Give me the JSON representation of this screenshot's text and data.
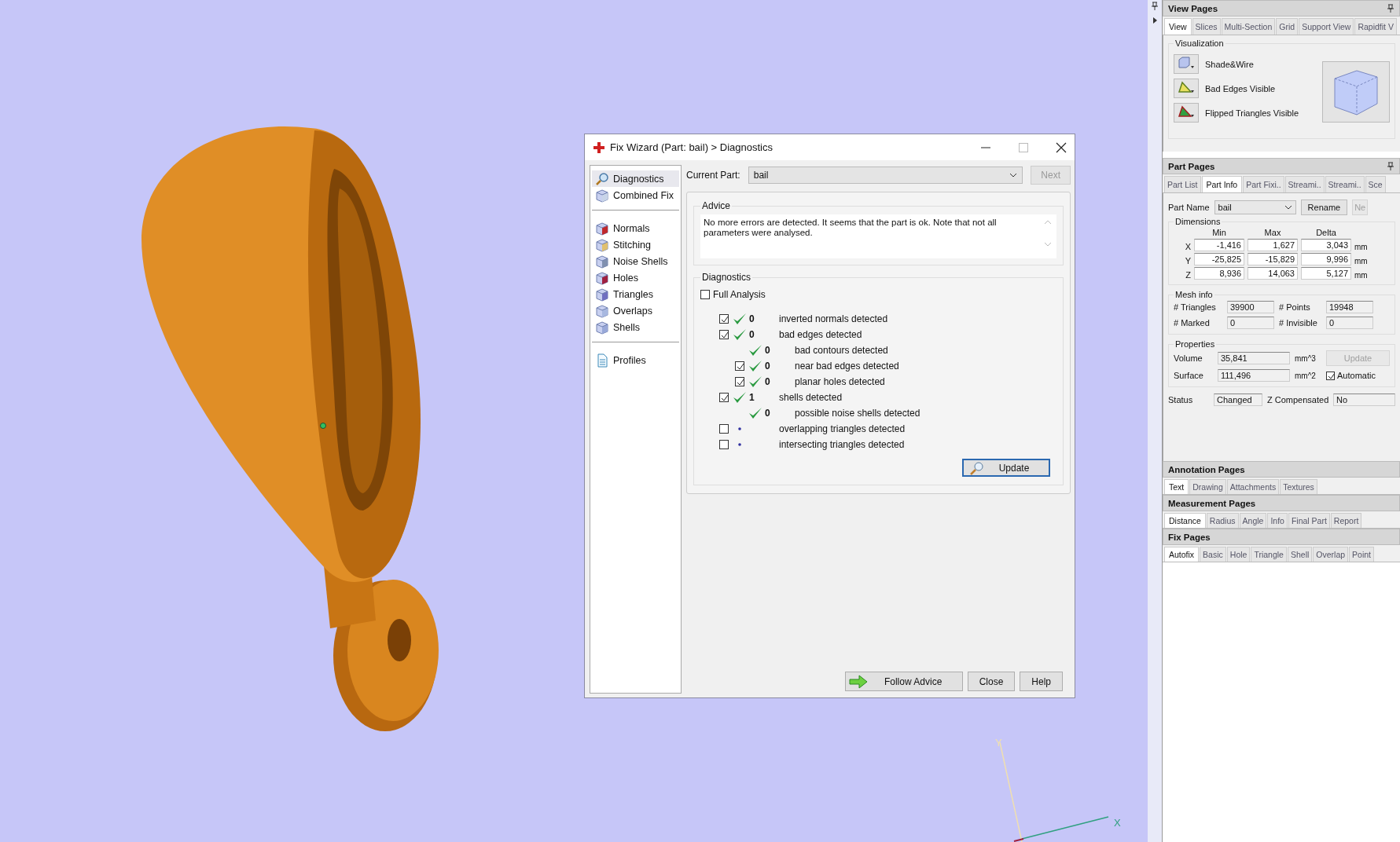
{
  "viewport": {
    "axes": {
      "x_label": "X",
      "y_label": "Y"
    }
  },
  "dialog": {
    "title": "Fix Wizard (Part: bail) > Diagnostics",
    "nav_groups": [
      [
        {
          "label": "Diagnostics",
          "selected": true
        },
        {
          "label": "Combined Fix",
          "selected": false
        }
      ],
      [
        {
          "label": "Normals",
          "selected": false
        },
        {
          "label": "Stitching",
          "selected": false
        },
        {
          "label": "Noise Shells",
          "selected": false
        },
        {
          "label": "Holes",
          "selected": false
        },
        {
          "label": "Triangles",
          "selected": false
        },
        {
          "label": "Overlaps",
          "selected": false
        },
        {
          "label": "Shells",
          "selected": false
        }
      ],
      [
        {
          "label": "Profiles",
          "selected": false
        }
      ]
    ],
    "current_part_label": "Current Part:",
    "current_part": "bail",
    "next_button": {
      "label": "Next",
      "disabled": true
    },
    "advice": {
      "title": "Advice",
      "text": "No more errors are detected. It seems that the part is ok. Note that not all parameters were analysed."
    },
    "diagnostics": {
      "title": "Diagnostics",
      "full_analysis": {
        "label": "Full Analysis",
        "checked": false
      },
      "items": [
        {
          "kind": "checkbox",
          "checked": true,
          "passed": true,
          "count": "0",
          "label": "inverted normals detected"
        },
        {
          "kind": "checkbox",
          "checked": true,
          "passed": true,
          "count": "0",
          "label": "bad edges detected",
          "children": [
            {
              "kind": "plain",
              "passed": true,
              "count": "0",
              "label": "bad contours detected"
            },
            {
              "kind": "checkbox",
              "checked": true,
              "passed": true,
              "count": "0",
              "label": "near bad edges detected"
            },
            {
              "kind": "checkbox",
              "checked": true,
              "passed": true,
              "count": "0",
              "label": "planar holes detected"
            }
          ]
        },
        {
          "kind": "checkbox",
          "checked": true,
          "passed": true,
          "count": "1",
          "label": "shells detected",
          "children": [
            {
              "kind": "plain",
              "passed": true,
              "count": "0",
              "label": "possible noise shells detected"
            }
          ]
        },
        {
          "kind": "checkbox",
          "checked": false,
          "passed": false,
          "label": "overlapping triangles detected"
        },
        {
          "kind": "checkbox",
          "checked": false,
          "passed": false,
          "label": "intersecting triangles detected"
        }
      ],
      "update_button": "Update"
    },
    "buttons": [
      {
        "label": "Follow Advice",
        "kind": "advice"
      },
      {
        "label": "Close",
        "kind": "plain"
      },
      {
        "label": "Help",
        "kind": "plain"
      }
    ]
  },
  "panel": {
    "view_pages": {
      "title": "View Pages",
      "tabs": [
        {
          "label": "View",
          "selected": true
        },
        {
          "label": "Slices",
          "selected": false
        },
        {
          "label": "Multi-Section",
          "selected": false
        },
        {
          "label": "Grid",
          "selected": false
        },
        {
          "label": "Support View",
          "selected": false
        },
        {
          "label": "Rapidfit V",
          "selected": false
        }
      ],
      "group": "Visualization",
      "toggles": [
        {
          "label": "Shade&Wire",
          "kind": "shade"
        },
        {
          "label": "Bad Edges Visible",
          "kind": "edges"
        },
        {
          "label": "Flipped Triangles Visible",
          "kind": "flipped"
        }
      ]
    },
    "part_pages": {
      "title": "Part Pages",
      "tabs": [
        {
          "label": "Part List",
          "selected": false
        },
        {
          "label": "Part Info",
          "selected": true
        },
        {
          "label": "Part Fixi..",
          "selected": false
        },
        {
          "label": "Streami..",
          "selected": false
        },
        {
          "label": "Streami..",
          "selected": false
        },
        {
          "label": "Sce",
          "selected": false
        }
      ],
      "part_name_label": "Part Name",
      "part_name": "bail",
      "rename_button": "Rename",
      "new_button": {
        "label": "Ne",
        "disabled": true
      },
      "dimensions": {
        "title": "Dimensions",
        "columns": [
          "Min",
          "Max",
          "Delta"
        ],
        "rows": [
          {
            "axis": "X",
            "values": [
              "-1,416",
              "1,627",
              "3,043"
            ],
            "unit": "mm"
          },
          {
            "axis": "Y",
            "values": [
              "-25,825",
              "-15,829",
              "9,996"
            ],
            "unit": "mm"
          },
          {
            "axis": "Z",
            "values": [
              "8,936",
              "14,063",
              "5,127"
            ],
            "unit": "mm"
          }
        ]
      },
      "mesh_info": {
        "title": "Mesh info",
        "fields": [
          {
            "label": "# Triangles",
            "value": "39900"
          },
          {
            "label": "# Points",
            "value": "19948"
          },
          {
            "label": "# Marked",
            "value": "0"
          },
          {
            "label": "# Invisible",
            "value": "0"
          }
        ]
      },
      "properties": {
        "title": "Properties",
        "fields": [
          {
            "label": "Volume",
            "value": "35,841",
            "unit": "mm^3"
          },
          {
            "label": "Surface",
            "value": "111,496",
            "unit": "mm^2"
          }
        ],
        "update_button": {
          "label": "Update",
          "disabled": true
        },
        "automatic": {
          "label": "Automatic",
          "checked": true
        }
      },
      "status": {
        "label": "Status",
        "value": "Changed"
      },
      "z_compensated": {
        "label": "Z Compensated",
        "value": "No"
      }
    },
    "sections": [
      {
        "title": "Annotation Pages",
        "tabs": [
          {
            "label": "Text",
            "selected": true
          },
          {
            "label": "Drawing",
            "selected": false
          },
          {
            "label": "Attachments",
            "selected": false
          },
          {
            "label": "Textures",
            "selected": false
          }
        ]
      },
      {
        "title": "Measurement Pages",
        "tabs": [
          {
            "label": "Distance",
            "selected": true
          },
          {
            "label": "Radius",
            "selected": false
          },
          {
            "label": "Angle",
            "selected": false
          },
          {
            "label": "Info",
            "selected": false
          },
          {
            "label": "Final Part",
            "selected": false
          },
          {
            "label": "Report",
            "selected": false
          }
        ]
      },
      {
        "title": "Fix Pages",
        "tabs": [
          {
            "label": "Autofix",
            "selected": true
          },
          {
            "label": "Basic",
            "selected": false
          },
          {
            "label": "Hole",
            "selected": false
          },
          {
            "label": "Triangle",
            "selected": false
          },
          {
            "label": "Shell",
            "selected": false
          },
          {
            "label": "Overlap",
            "selected": false
          },
          {
            "label": "Point",
            "selected": false
          }
        ]
      }
    ]
  }
}
